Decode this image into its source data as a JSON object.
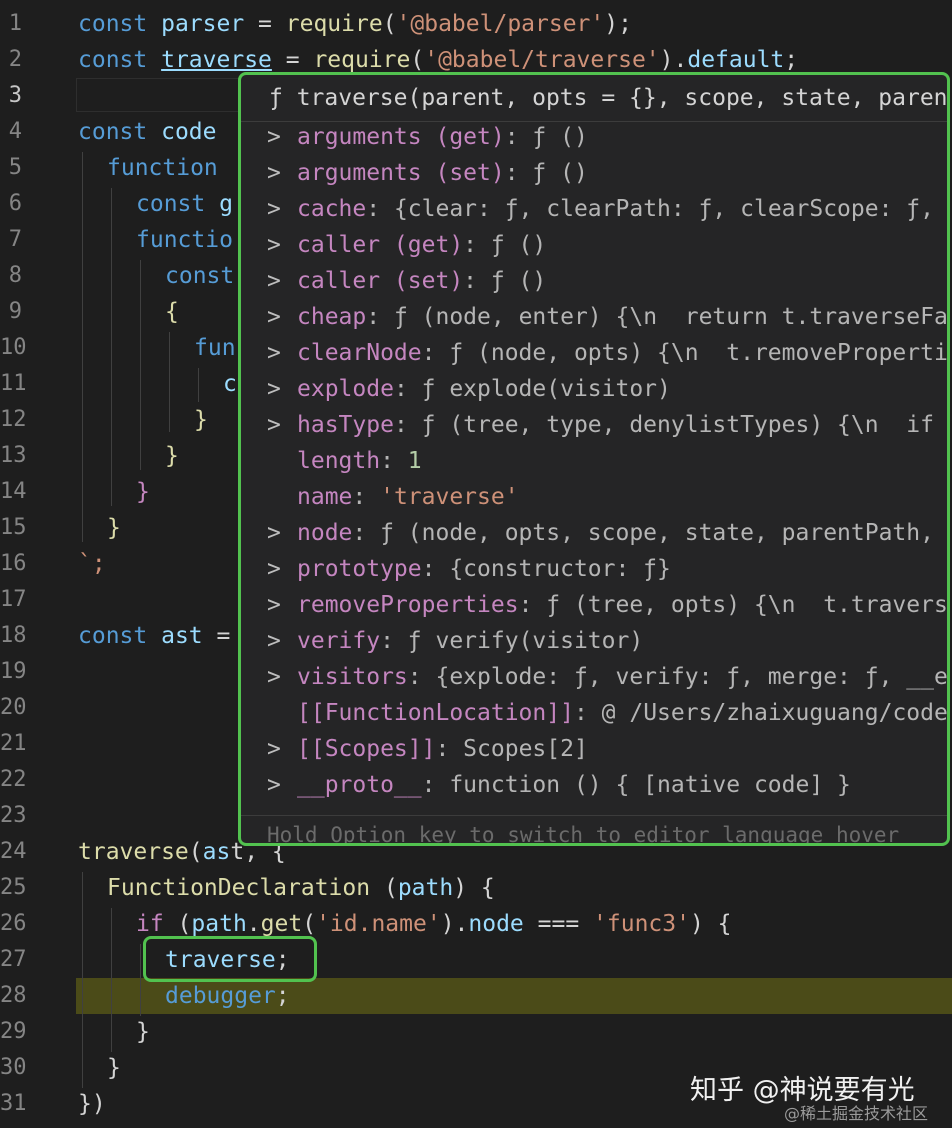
{
  "editor": {
    "line_numbers": [
      "1",
      "2",
      "3",
      "4",
      "5",
      "6",
      "7",
      "8",
      "9",
      "10",
      "11",
      "12",
      "13",
      "14",
      "15",
      "16",
      "17",
      "18",
      "19",
      "20",
      "21",
      "22",
      "23",
      "24",
      "25",
      "26",
      "27",
      "28",
      "29",
      "30",
      "31"
    ],
    "active_line": "3",
    "lines": {
      "l1": {
        "kw": "const",
        "var": "parser",
        "eq": " = ",
        "fn": "require",
        "open": "(",
        "str": "'@babel/parser'",
        "close": ");"
      },
      "l2": {
        "kw": "const",
        "var": "traverse",
        "eq": " = ",
        "fn": "require",
        "open": "(",
        "str": "'@babel/traverse'",
        "close": ").",
        "prop": "default",
        "end": ";"
      },
      "l4": {
        "kw": "const",
        "var": "code"
      },
      "l5": {
        "kw": "function"
      },
      "l6": {
        "kw": "const",
        "frag": "g"
      },
      "l7": {
        "kw": "functio"
      },
      "l8": {
        "kw": "const"
      },
      "l9": {
        "text": "{"
      },
      "l10": {
        "kw": "fun"
      },
      "l11": {
        "frag": "c"
      },
      "l12": {
        "text": "}"
      },
      "l13": {
        "text": "}"
      },
      "l14": {
        "text": "}"
      },
      "l15": {
        "text": "}"
      },
      "l16": {
        "text": "`;"
      },
      "l18": {
        "kw": "const",
        "var": "ast",
        "eq": " ="
      },
      "l24": {
        "fn": "traverse",
        "open": "(",
        "var": "as",
        "rest": "t, {"
      },
      "l25": {
        "fn": "FunctionDeclaration",
        "open": " (",
        "var": "path",
        "close": ") {"
      },
      "l26": {
        "ctl": "if",
        "open": " (",
        "var": "path",
        "dot": ".",
        "fn": "get",
        "open2": "(",
        "str": "'id.name'",
        "close": ").",
        "prop": "node",
        "op": " === ",
        "str2": "'func3'",
        "end": ") {"
      },
      "l27": {
        "var": "traverse",
        "end": ";"
      },
      "l28": {
        "kw": "debugger",
        "end": ";"
      },
      "l29": {
        "text": "}"
      },
      "l30": {
        "text": "}"
      },
      "l31": {
        "text": "})"
      }
    }
  },
  "hover": {
    "signature": "ƒ traverse(parent, opts = {}, scope, state, parentPa",
    "properties": [
      {
        "chevron": ">",
        "name": "arguments (get)",
        "value": ": ƒ ()"
      },
      {
        "chevron": ">",
        "name": "arguments (set)",
        "value": ": ƒ ()"
      },
      {
        "chevron": ">",
        "name": "cache",
        "value": ": {clear: ƒ, clearPath: ƒ, clearScope: ƒ, pat"
      },
      {
        "chevron": ">",
        "name": "caller (get)",
        "value": ": ƒ ()"
      },
      {
        "chevron": ">",
        "name": "caller (set)",
        "value": ": ƒ ()"
      },
      {
        "chevron": ">",
        "name": "cheap",
        "value": ": ƒ (node, enter) {\\n  return t.traverseFast("
      },
      {
        "chevron": ">",
        "name": "clearNode",
        "value": ": ƒ (node, opts) {\\n  t.removeProperties("
      },
      {
        "chevron": ">",
        "name": "explode",
        "value": ": ƒ explode(visitor)"
      },
      {
        "chevron": ">",
        "name": "hasType",
        "value": ": ƒ (tree, type, denylistTypes) {\\n  if (de"
      },
      {
        "chevron": "",
        "name": "length",
        "value": ": ",
        "num": "1"
      },
      {
        "chevron": "",
        "name": "name",
        "value": ": ",
        "sval": "'traverse'"
      },
      {
        "chevron": ">",
        "name": "node",
        "value": ": ƒ (node, opts, scope, state, parentPath, ski"
      },
      {
        "chevron": ">",
        "name": "prototype",
        "value": ": {constructor: ƒ}"
      },
      {
        "chevron": ">",
        "name": "removeProperties",
        "value": ": ƒ (tree, opts) {\\n  t.traverseFa"
      },
      {
        "chevron": ">",
        "name": "verify",
        "value": ": ƒ verify(visitor)"
      },
      {
        "chevron": ">",
        "name": "visitors",
        "value": ": {explode: ƒ, verify: ƒ, merge: ƒ, __esMo"
      },
      {
        "chevron": "",
        "name": "[[FunctionLocation]]",
        "value": ": @ /Users/zhaixuguang/code/re"
      },
      {
        "chevron": ">",
        "name": "[[Scopes]]",
        "value": ": Scopes[2]"
      },
      {
        "chevron": ">",
        "name": "__proto__",
        "value": ": function () { [native code] }"
      }
    ],
    "footer": "Hold Option key to switch to editor language hover"
  },
  "watermark": {
    "line1": "知乎 @神说要有光",
    "line2": "@稀土掘金技术社区"
  },
  "colors": {
    "highlight_box": "#52c24f",
    "debug_line": "#4b4b18",
    "background": "#1e1e1e"
  }
}
